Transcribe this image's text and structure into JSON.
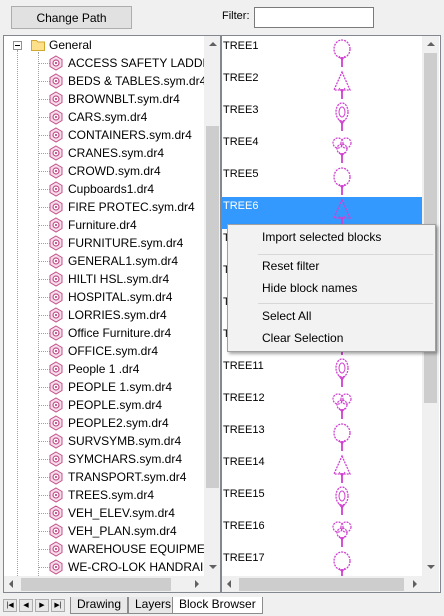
{
  "toolbar": {
    "change_path_label": "Change Path",
    "filter_label": "Filter:",
    "filter_value": ""
  },
  "tree": {
    "root_label": "General",
    "items": [
      "ACCESS SAFETY LADDER.s",
      "BEDS & TABLES.sym.dr4",
      "BROWNBLT.sym.dr4",
      "CARS.sym.dr4",
      "CONTAINERS.sym.dr4",
      "CRANES.sym.dr4",
      "CROWD.sym.dr4",
      "Cupboards1.dr4",
      "FIRE PROTEC.sym.dr4",
      "Furniture.dr4",
      "FURNITURE.sym.dr4",
      "GENERAL1.sym.dr4",
      "HILTI HSL.sym.dr4",
      "HOSPITAL.sym.dr4",
      "LORRIES.sym.dr4",
      "Office Furniture.dr4",
      "OFFICE.sym.dr4",
      "People 1 .dr4",
      "PEOPLE 1.sym.dr4",
      "PEOPLE.sym.dr4",
      "PEOPLE2.sym.dr4",
      "SURVSYMB.sym.dr4",
      "SYMCHARS.sym.dr4",
      "TRANSPORT.sym.dr4",
      "TREES.sym.dr4",
      "VEH_ELEV.sym.dr4",
      "VEH_PLAN.sym.dr4",
      "WAREHOUSE EQUIPMENT",
      "WE-CRO-LOK HANDRAILI"
    ]
  },
  "blocks": {
    "items": [
      "TREE1",
      "TREE2",
      "TREE3",
      "TREE4",
      "TREE5",
      "TREE6",
      "TREE7",
      "TREE8",
      "TREE9",
      "TREE10",
      "TREE11",
      "TREE12",
      "TREE13",
      "TREE14",
      "TREE15",
      "TREE16",
      "TREE17"
    ],
    "selected": "TREE6"
  },
  "context_menu": {
    "import_label": "Import selected blocks",
    "reset_filter_label": "Reset filter",
    "hide_names_label": "Hide block names",
    "select_all_label": "Select All",
    "clear_selection_label": "Clear Selection"
  },
  "tabs": {
    "drawing": "Drawing",
    "layers": "Layers",
    "block_browser": "Block Browser"
  },
  "nav": {
    "first": "|◀",
    "prev": "◀",
    "next": "▶",
    "last": "▶|"
  },
  "colors": {
    "symbol": "#d040d0",
    "selection": "#3399ff"
  }
}
